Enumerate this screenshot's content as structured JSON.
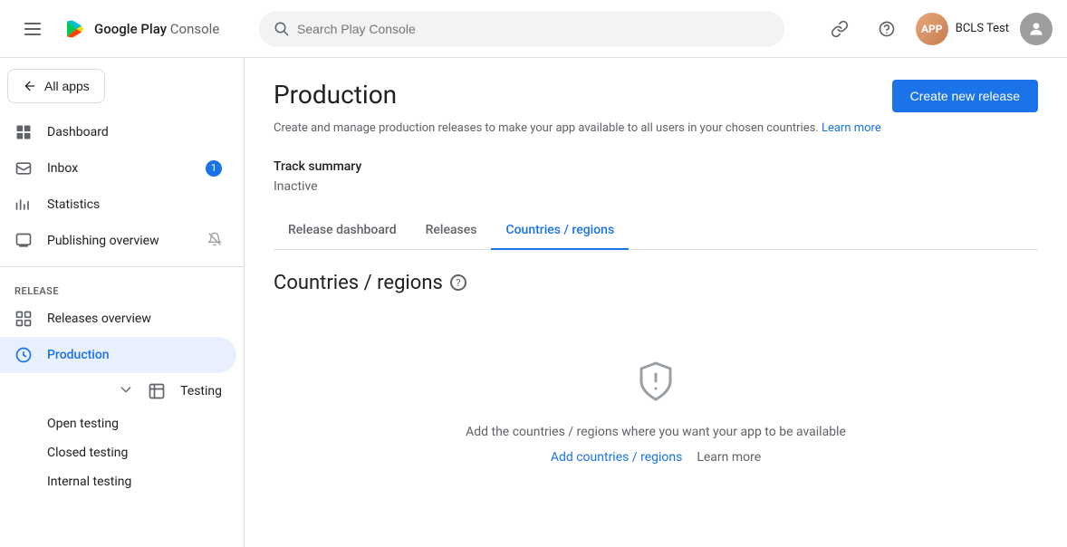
{
  "header": {
    "menu_label": "Menu",
    "logo_text_strong": "Google Play",
    "logo_text_light": " Console",
    "search_placeholder": "Search Play Console",
    "link_icon_label": "Copy link",
    "help_icon_label": "Help",
    "user_name": "BCLS Test"
  },
  "sidebar": {
    "back_button": "All apps",
    "nav_items": [
      {
        "id": "dashboard",
        "label": "Dashboard",
        "icon": "dashboard-icon",
        "badge": null
      },
      {
        "id": "inbox",
        "label": "Inbox",
        "icon": "inbox-icon",
        "badge": "1"
      },
      {
        "id": "statistics",
        "label": "Statistics",
        "icon": "statistics-icon",
        "badge": null
      },
      {
        "id": "publishing-overview",
        "label": "Publishing overview",
        "icon": "publishing-icon",
        "badge": null,
        "has_mute": true
      }
    ],
    "release_section_label": "Release",
    "release_items": [
      {
        "id": "releases-overview",
        "label": "Releases overview",
        "icon": "releases-overview-icon"
      },
      {
        "id": "production",
        "label": "Production",
        "icon": "production-icon",
        "active": true
      },
      {
        "id": "testing",
        "label": "Testing",
        "icon": "testing-icon",
        "has_chevron": true
      }
    ],
    "testing_sub_items": [
      {
        "id": "open-testing",
        "label": "Open testing"
      },
      {
        "id": "closed-testing",
        "label": "Closed testing"
      },
      {
        "id": "internal-testing",
        "label": "Internal testing"
      }
    ]
  },
  "page": {
    "title": "Production",
    "description": "Create and manage production releases to make your app available to all users in your chosen countries.",
    "learn_more_text": "Learn more",
    "create_button": "Create new release",
    "track_summary_label": "Track summary",
    "track_status": "Inactive",
    "tabs": [
      {
        "id": "release-dashboard",
        "label": "Release dashboard",
        "active": false
      },
      {
        "id": "releases",
        "label": "Releases",
        "active": false
      },
      {
        "id": "countries-regions",
        "label": "Countries / regions",
        "active": true
      }
    ],
    "section_title": "Countries / regions",
    "empty_state": {
      "text": "Add the countries / regions where you want your app to be available",
      "action_link": "Add countries / regions",
      "action_secondary": "Learn more"
    }
  }
}
